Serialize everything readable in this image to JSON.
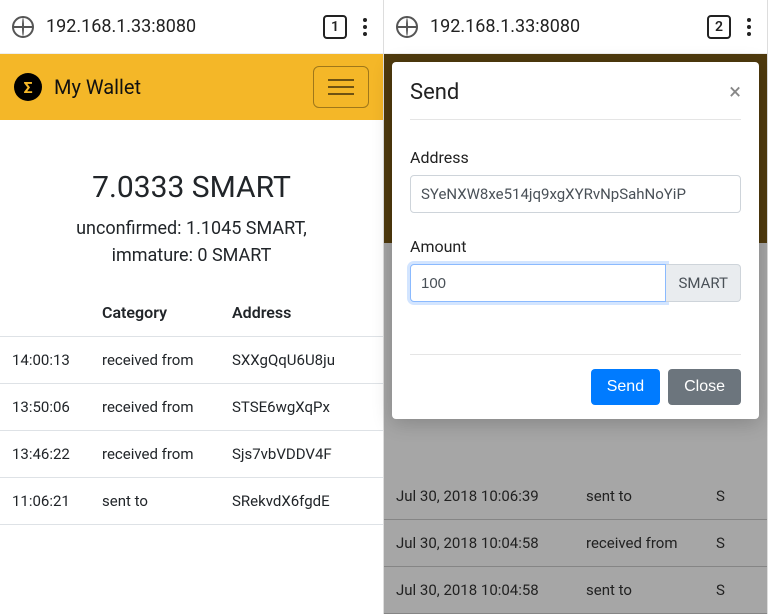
{
  "left": {
    "chrome": {
      "url": "192.168.1.33:8080",
      "tabcount": "1"
    },
    "app_title": "My Wallet",
    "balance": {
      "main": "7.0333 SMART",
      "sub1": "unconfirmed: 1.1045 SMART,",
      "sub2": "immature: 0 SMART"
    },
    "headers": {
      "cat": "Category",
      "addr": "Address"
    },
    "rows": [
      {
        "time": "14:00:13",
        "cat": "received from",
        "addr": "SXXgQqU6U8ju"
      },
      {
        "time": "13:50:06",
        "cat": "received from",
        "addr": "STSE6wgXqPx"
      },
      {
        "time": "13:46:22",
        "cat": "received from",
        "addr": "Sjs7vbVDDV4F"
      },
      {
        "time": "11:06:21",
        "cat": "sent to",
        "addr": "SRekvdX6fgdE"
      }
    ]
  },
  "right": {
    "chrome": {
      "url": "192.168.1.33:8080",
      "tabcount": "2"
    },
    "modal": {
      "title": "Send",
      "address_label": "Address",
      "address_value": "SYeNXW8xe514jq9xgXYRvNpSahNoYiP",
      "amount_label": "Amount",
      "amount_value": "100",
      "amount_unit": "SMART",
      "send_btn": "Send",
      "close_btn": "Close"
    },
    "bg_rows": [
      {
        "time": "Jul 30, 2018 10:06:39",
        "cat": "sent to",
        "addr": "S"
      },
      {
        "time": "Jul 30, 2018 10:04:58",
        "cat": "received from",
        "addr": "S"
      },
      {
        "time": "Jul 30, 2018 10:04:58",
        "cat": "sent to",
        "addr": "S"
      }
    ]
  }
}
